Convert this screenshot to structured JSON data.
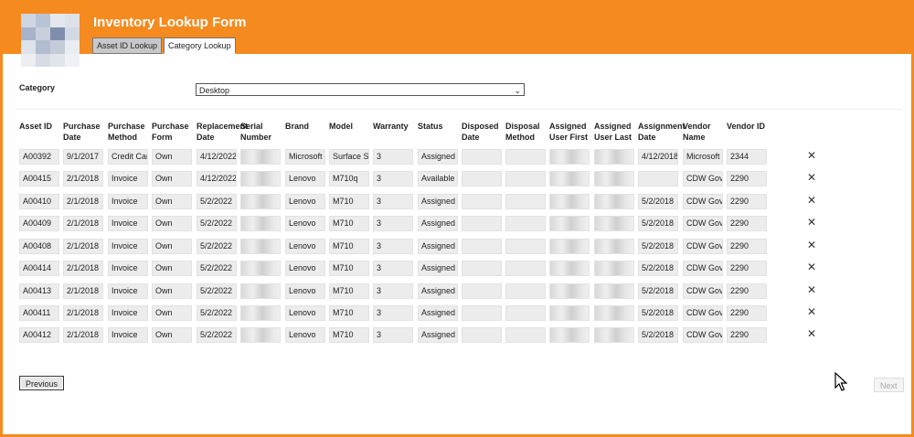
{
  "header": {
    "title": "Inventory Lookup Form"
  },
  "tabs": [
    {
      "label": "Asset ID Lookup",
      "active": false
    },
    {
      "label": "Category Lookup",
      "active": true
    }
  ],
  "filter": {
    "label": "Category",
    "value": "Desktop"
  },
  "columns": [
    "Asset ID",
    "Purchase Date",
    "Purchase Method",
    "Purchase Form",
    "Replacement Date",
    "Serial Number",
    "Brand",
    "Model",
    "Warranty",
    "Status",
    "Disposed Date",
    "Disposal Method",
    "Assigned User First",
    "Assigned User Last",
    "Assignment Date",
    "Vendor Name",
    "Vendor ID"
  ],
  "rows": [
    {
      "asset_id": "A00392",
      "purchase_date": "9/1/2017",
      "purchase_method": "Credit Car",
      "purchase_form": "Own",
      "replacement_date": "4/12/2022",
      "brand": "Microsoft",
      "model": "Surface St",
      "warranty": "3",
      "status": "Assigned",
      "assignment_date": "4/12/2018",
      "vendor_name": "Microsoft",
      "vendor_id": "2344"
    },
    {
      "asset_id": "A00415",
      "purchase_date": "2/1/2018",
      "purchase_method": "Invoice",
      "purchase_form": "Own",
      "replacement_date": "4/12/2022",
      "brand": "Lenovo",
      "model": "M710q",
      "warranty": "3",
      "status": "Available",
      "assignment_date": "",
      "vendor_name": "CDW Gove",
      "vendor_id": "2290"
    },
    {
      "asset_id": "A00410",
      "purchase_date": "2/1/2018",
      "purchase_method": "Invoice",
      "purchase_form": "Own",
      "replacement_date": "5/2/2022",
      "brand": "Lenovo",
      "model": "M710",
      "warranty": "3",
      "status": "Assigned",
      "assignment_date": "5/2/2018",
      "vendor_name": "CDW Gove",
      "vendor_id": "2290"
    },
    {
      "asset_id": "A00409",
      "purchase_date": "2/1/2018",
      "purchase_method": "Invoice",
      "purchase_form": "Own",
      "replacement_date": "5/2/2022",
      "brand": "Lenovo",
      "model": "M710",
      "warranty": "3",
      "status": "Assigned",
      "assignment_date": "5/2/2018",
      "vendor_name": "CDW Gove",
      "vendor_id": "2290"
    },
    {
      "asset_id": "A00408",
      "purchase_date": "2/1/2018",
      "purchase_method": "Invoice",
      "purchase_form": "Own",
      "replacement_date": "5/2/2022",
      "brand": "Lenovo",
      "model": "M710",
      "warranty": "3",
      "status": "Assigned",
      "assignment_date": "5/2/2018",
      "vendor_name": "CDW Gove",
      "vendor_id": "2290"
    },
    {
      "asset_id": "A00414",
      "purchase_date": "2/1/2018",
      "purchase_method": "Invoice",
      "purchase_form": "Own",
      "replacement_date": "5/2/2022",
      "brand": "Lenovo",
      "model": "M710",
      "warranty": "3",
      "status": "Assigned",
      "assignment_date": "5/2/2018",
      "vendor_name": "CDW Gove",
      "vendor_id": "2290"
    },
    {
      "asset_id": "A00413",
      "purchase_date": "2/1/2018",
      "purchase_method": "Invoice",
      "purchase_form": "Own",
      "replacement_date": "5/2/2022",
      "brand": "Lenovo",
      "model": "M710",
      "warranty": "3",
      "status": "Assigned",
      "assignment_date": "5/2/2018",
      "vendor_name": "CDW Gove",
      "vendor_id": "2290"
    },
    {
      "asset_id": "A00411",
      "purchase_date": "2/1/2018",
      "purchase_method": "Invoice",
      "purchase_form": "Own",
      "replacement_date": "5/2/2022",
      "brand": "Lenovo",
      "model": "M710",
      "warranty": "3",
      "status": "Assigned",
      "assignment_date": "5/2/2018",
      "vendor_name": "CDW Gove",
      "vendor_id": "2290"
    },
    {
      "asset_id": "A00412",
      "purchase_date": "2/1/2018",
      "purchase_method": "Invoice",
      "purchase_form": "Own",
      "replacement_date": "5/2/2022",
      "brand": "Lenovo",
      "model": "M710",
      "warranty": "3",
      "status": "Assigned",
      "assignment_date": "5/2/2018",
      "vendor_name": "CDW Gove",
      "vendor_id": "2290"
    }
  ],
  "delete_glyph": "✕",
  "pager": {
    "previous_label": "Previous",
    "next_label": "Next"
  },
  "colors": {
    "header": "#f58a1f",
    "field_bg": "#ececec"
  }
}
